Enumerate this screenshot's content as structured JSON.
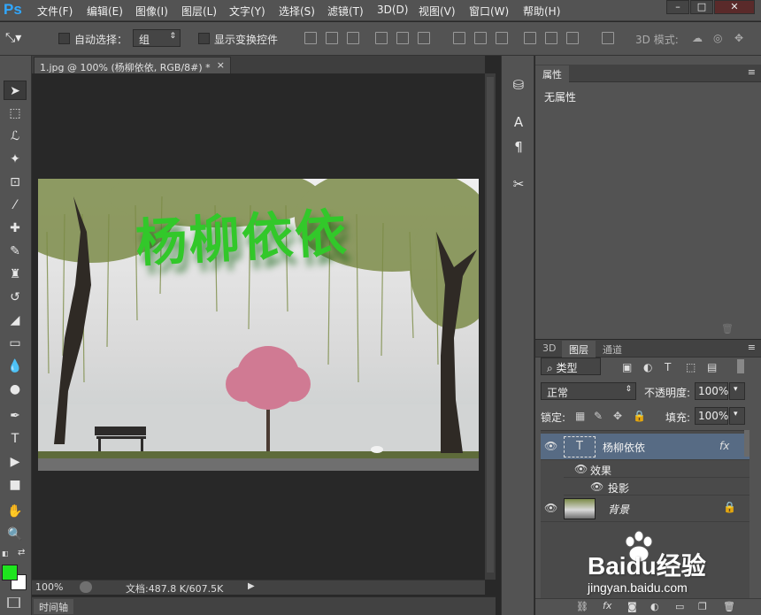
{
  "app": {
    "logo": "Ps"
  },
  "menu": [
    "文件(F)",
    "编辑(E)",
    "图像(I)",
    "图层(L)",
    "文字(Y)",
    "选择(S)",
    "滤镜(T)",
    "3D(D)",
    "视图(V)",
    "窗口(W)",
    "帮助(H)"
  ],
  "window_buttons": [
    "–",
    "□",
    "✕"
  ],
  "options": {
    "auto_select_label": "自动选择：",
    "auto_select_value": "组",
    "show_transform_label": "显示变换控件",
    "mode_label": "3D 模式:"
  },
  "document": {
    "tab_label": "1.jpg @ 100% (杨柳依依, RGB/8#) *",
    "close": "×",
    "image_text": "杨柳依依"
  },
  "status": {
    "zoom": "100%",
    "doc_info": "文档:487.8 K/607.5K"
  },
  "timeline_label": "时间轴",
  "properties": {
    "tab": "属性",
    "body": "无属性"
  },
  "layers": {
    "tabs": [
      "3D",
      "图层",
      "通道"
    ],
    "filter_kind": "类型",
    "blend_mode": "正常",
    "opacity_label": "不透明度:",
    "opacity_value": "100%",
    "lock_label": "锁定:",
    "fill_label": "填充:",
    "fill_value": "100%",
    "items": [
      {
        "name": "杨柳依依",
        "fx": "fx"
      },
      {
        "name": "效果"
      },
      {
        "name": "投影"
      },
      {
        "name": "背景"
      }
    ]
  },
  "watermark": {
    "brand": "Baidu经验",
    "url": "jingyan.baidu.com"
  },
  "colors": {
    "accent": "#31a8ff",
    "foreground": "#1ee51e",
    "background": "#ffffff",
    "text_effect": "#32c82a",
    "selected_layer": "#576b84"
  }
}
